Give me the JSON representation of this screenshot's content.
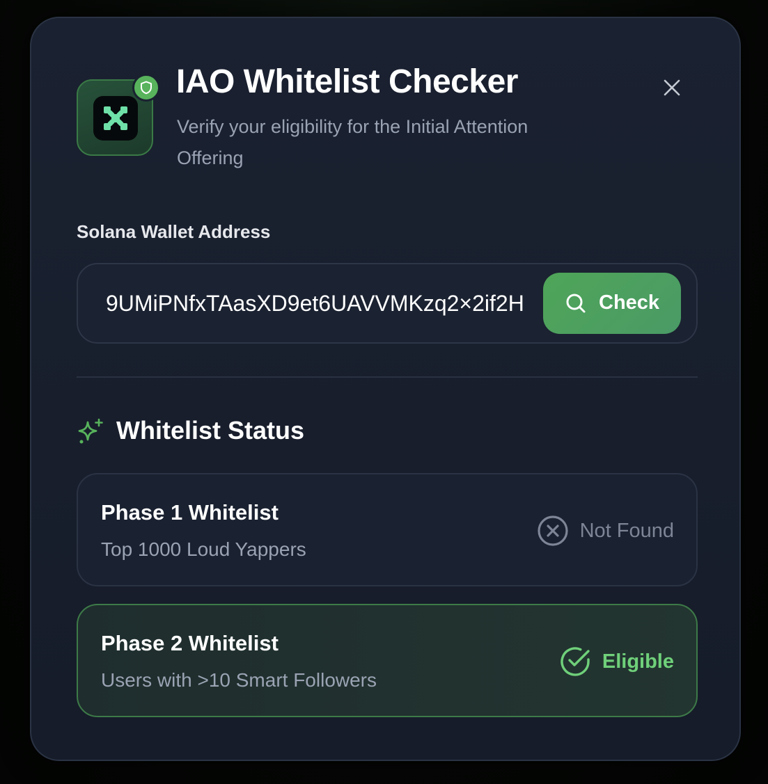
{
  "header": {
    "title": "IAO Whitelist Checker",
    "subtitle": "Verify your eligibility for the Initial Attention Offering"
  },
  "wallet": {
    "label": "Solana Wallet Address",
    "value": "9UMiPNfxTAasXD9et6UAVVMKzq2×2if2H",
    "check_label": "Check"
  },
  "status_section": {
    "title": "Whitelist Status",
    "phases": [
      {
        "name": "Phase 1 Whitelist",
        "description": "Top 1000 Loud Yappers",
        "status": "Not Found",
        "status_icon": "x-circle-icon"
      },
      {
        "name": "Phase 2 Whitelist",
        "description": "Users with >10 Smart Followers",
        "status": "Eligible",
        "status_icon": "check-circle-icon"
      }
    ]
  },
  "colors": {
    "accent": "#58b35c",
    "eligible_text": "#6fd07a",
    "muted_text": "#9aa3b3",
    "panel_bg": "#1a2130"
  }
}
